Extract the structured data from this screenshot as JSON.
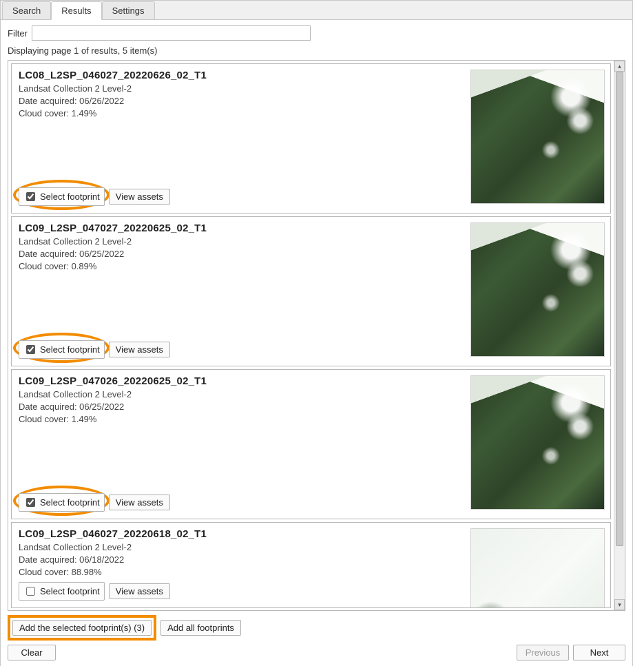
{
  "tabs": {
    "search": "Search",
    "results": "Results",
    "settings": "Settings"
  },
  "filter": {
    "label": "Filter",
    "value": ""
  },
  "status": "Displaying page 1 of results, 5 item(s)",
  "labels": {
    "date_acquired": "Date acquired:",
    "cloud_cover": "Cloud cover:",
    "select_footprint": "Select footprint",
    "view_assets": "View assets"
  },
  "results": [
    {
      "id": "LC08_L2SP_046027_20220626_02_T1",
      "collection": "Landsat Collection 2 Level-2",
      "date": "06/26/2022",
      "cloud": "1.49%",
      "checked": true,
      "highlighted": true,
      "cloudy": false
    },
    {
      "id": "LC09_L2SP_047027_20220625_02_T1",
      "collection": "Landsat Collection 2 Level-2",
      "date": "06/25/2022",
      "cloud": "0.89%",
      "checked": true,
      "highlighted": true,
      "cloudy": false
    },
    {
      "id": "LC09_L2SP_047026_20220625_02_T1",
      "collection": "Landsat Collection 2 Level-2",
      "date": "06/25/2022",
      "cloud": "1.49%",
      "checked": true,
      "highlighted": true,
      "cloudy": false
    },
    {
      "id": "LC09_L2SP_046027_20220618_02_T1",
      "collection": "Landsat Collection 2 Level-2",
      "date": "06/18/2022",
      "cloud": "88.98%",
      "checked": false,
      "highlighted": false,
      "cloudy": true
    }
  ],
  "footer": {
    "add_selected": "Add the selected footprint(s) (3)",
    "add_all": "Add all footprints",
    "clear": "Clear",
    "previous": "Previous",
    "next": "Next"
  }
}
